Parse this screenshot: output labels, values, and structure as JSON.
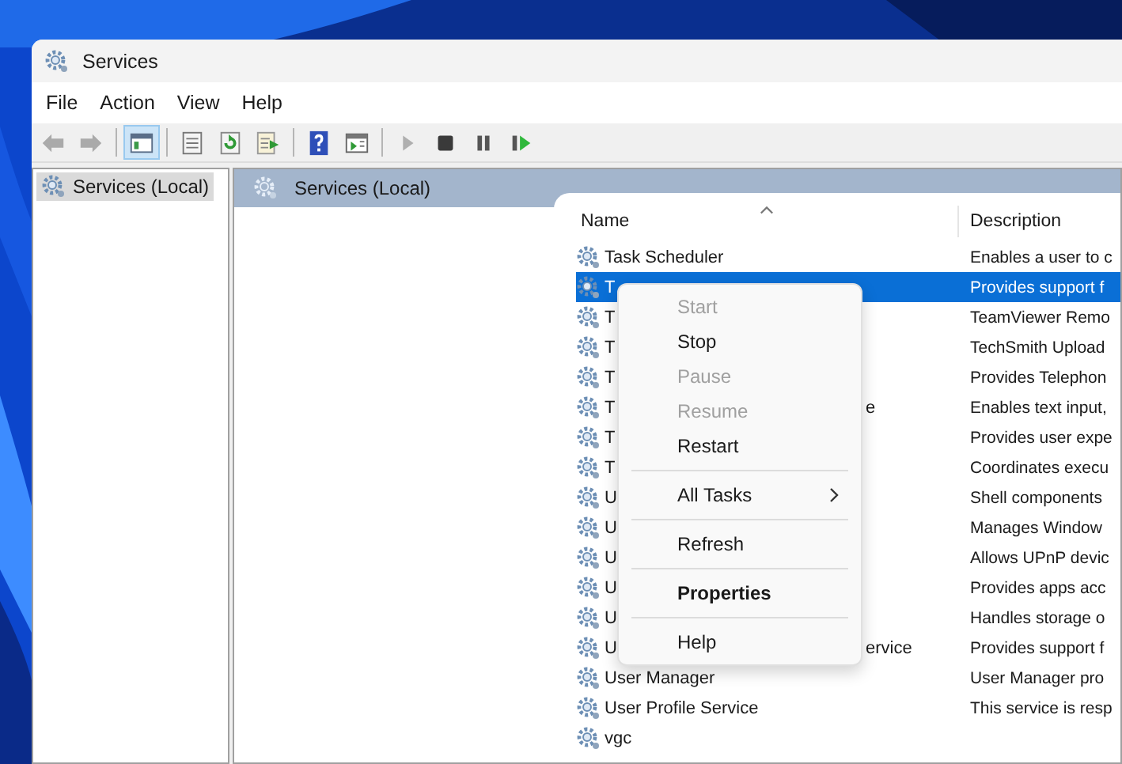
{
  "window": {
    "title": "Services"
  },
  "menu": [
    "File",
    "Action",
    "View",
    "Help"
  ],
  "toolbar": [
    [
      {
        "kind": "back",
        "pressed": false,
        "disabled": true
      },
      {
        "kind": "forward",
        "pressed": false,
        "disabled": true
      }
    ],
    [
      {
        "kind": "tree",
        "pressed": true,
        "disabled": false
      }
    ],
    [
      {
        "kind": "list",
        "pressed": false,
        "disabled": false
      },
      {
        "kind": "refresh",
        "pressed": false,
        "disabled": false
      },
      {
        "kind": "export",
        "pressed": false,
        "disabled": false
      }
    ],
    [
      {
        "kind": "help",
        "pressed": false,
        "disabled": false
      },
      {
        "kind": "view",
        "pressed": false,
        "disabled": false
      }
    ],
    [
      {
        "kind": "play",
        "pressed": false,
        "disabled": true
      },
      {
        "kind": "stop",
        "pressed": false,
        "disabled": false
      },
      {
        "kind": "pause",
        "pressed": false,
        "disabled": false
      },
      {
        "kind": "resume",
        "pressed": false,
        "disabled": false
      }
    ]
  ],
  "tree": {
    "items": [
      {
        "label": "Services (Local)",
        "selected": true
      }
    ]
  },
  "pane": {
    "title": "Services (Local)"
  },
  "table": {
    "columns": [
      "Name",
      "Description"
    ],
    "rows": [
      {
        "name": "Task Scheduler",
        "description": "Enables a user to c",
        "selected": false
      },
      {
        "name": "T",
        "description": "Provides support f",
        "selected": true
      },
      {
        "name": "T",
        "description": "TeamViewer Remo",
        "selected": false
      },
      {
        "name": "T",
        "description": "TechSmith Upload",
        "selected": false
      },
      {
        "name": "T",
        "description": "Provides Telephon",
        "selected": false
      },
      {
        "name": "T",
        "name_tail": "e",
        "description": "Enables text input,",
        "selected": false
      },
      {
        "name": "T",
        "description": "Provides user expe",
        "selected": false
      },
      {
        "name": "T",
        "description": "Coordinates execu",
        "selected": false
      },
      {
        "name": "U",
        "description": "Shell components",
        "selected": false
      },
      {
        "name": "U",
        "description": "Manages Window",
        "selected": false
      },
      {
        "name": "U",
        "description": "Allows UPnP devic",
        "selected": false
      },
      {
        "name": "U",
        "description": "Provides apps acc",
        "selected": false
      },
      {
        "name": "U",
        "description": "Handles storage o",
        "selected": false
      },
      {
        "name": "U",
        "name_tail": "ervice",
        "description": "Provides support f",
        "selected": false
      },
      {
        "name": "User Manager",
        "description": "User Manager pro",
        "selected": false
      },
      {
        "name": "User Profile Service",
        "description": "This service is resp",
        "selected": false
      },
      {
        "name": "vgc",
        "selected": false
      }
    ]
  },
  "context_menu": [
    {
      "kind": "item",
      "label": "Start",
      "disabled": true,
      "bold": false,
      "submenu": false
    },
    {
      "kind": "item",
      "label": "Stop",
      "disabled": false,
      "bold": false,
      "submenu": false
    },
    {
      "kind": "item",
      "label": "Pause",
      "disabled": true,
      "bold": false,
      "submenu": false
    },
    {
      "kind": "item",
      "label": "Resume",
      "disabled": true,
      "bold": false,
      "submenu": false
    },
    {
      "kind": "item",
      "label": "Restart",
      "disabled": false,
      "bold": false,
      "submenu": false
    },
    {
      "kind": "separator"
    },
    {
      "kind": "item",
      "label": "All Tasks",
      "disabled": false,
      "bold": false,
      "submenu": true
    },
    {
      "kind": "separator"
    },
    {
      "kind": "item",
      "label": "Refresh",
      "disabled": false,
      "bold": false,
      "submenu": false
    },
    {
      "kind": "separator"
    },
    {
      "kind": "item",
      "label": "Properties",
      "disabled": false,
      "bold": true,
      "submenu": false
    },
    {
      "kind": "separator"
    },
    {
      "kind": "item",
      "label": "Help",
      "disabled": false,
      "bold": false,
      "submenu": false
    }
  ]
}
